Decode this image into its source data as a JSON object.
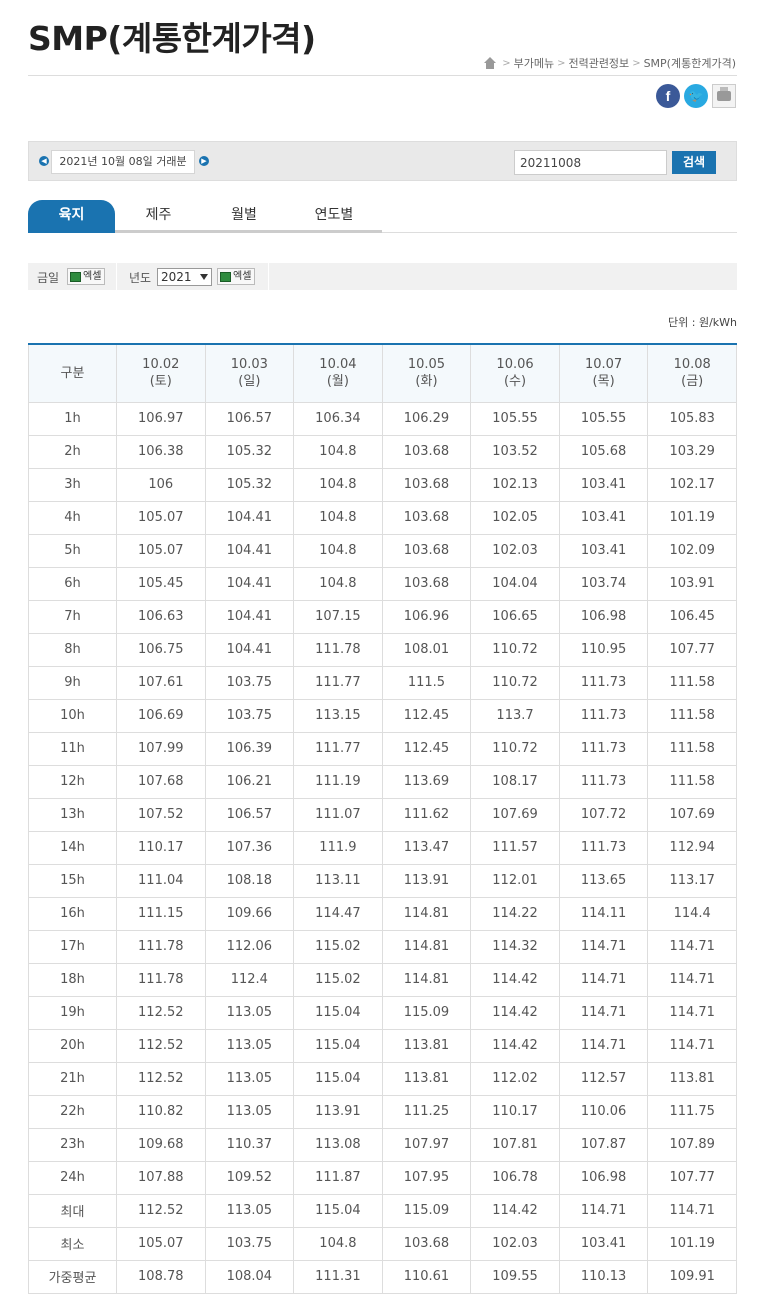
{
  "page": {
    "title": "SMP(계통한계가격)",
    "breadcrumb": [
      "부가메뉴",
      "전력관련정보",
      "SMP(계통한계가격)"
    ]
  },
  "share": {
    "facebook": "f",
    "twitter": "t",
    "print": "print-icon"
  },
  "search": {
    "date_label": "2021년 10월 08일 거래분",
    "input_value": "20211008",
    "button_label": "검색"
  },
  "tabs": [
    {
      "label": "육지",
      "active": true
    },
    {
      "label": "제주",
      "active": false
    },
    {
      "label": "월별",
      "active": false
    },
    {
      "label": "연도별",
      "active": false
    }
  ],
  "options": {
    "today_label": "금일",
    "excel_label": "엑셀",
    "year_label": "년도",
    "year_value": "2021",
    "excel_label2": "엑셀"
  },
  "unit": "단위 : 원/kWh",
  "table": {
    "first_col_header": "구분",
    "columns": [
      {
        "date": "10.02",
        "day": "(토)"
      },
      {
        "date": "10.03",
        "day": "(일)"
      },
      {
        "date": "10.04",
        "day": "(월)"
      },
      {
        "date": "10.05",
        "day": "(화)"
      },
      {
        "date": "10.06",
        "day": "(수)"
      },
      {
        "date": "10.07",
        "day": "(목)"
      },
      {
        "date": "10.08",
        "day": "(금)"
      }
    ],
    "rows": [
      {
        "label": "1h",
        "values": [
          "106.97",
          "106.57",
          "106.34",
          "106.29",
          "105.55",
          "105.55",
          "105.83"
        ]
      },
      {
        "label": "2h",
        "values": [
          "106.38",
          "105.32",
          "104.8",
          "103.68",
          "103.52",
          "105.68",
          "103.29"
        ]
      },
      {
        "label": "3h",
        "values": [
          "106",
          "105.32",
          "104.8",
          "103.68",
          "102.13",
          "103.41",
          "102.17"
        ]
      },
      {
        "label": "4h",
        "values": [
          "105.07",
          "104.41",
          "104.8",
          "103.68",
          "102.05",
          "103.41",
          "101.19"
        ]
      },
      {
        "label": "5h",
        "values": [
          "105.07",
          "104.41",
          "104.8",
          "103.68",
          "102.03",
          "103.41",
          "102.09"
        ]
      },
      {
        "label": "6h",
        "values": [
          "105.45",
          "104.41",
          "104.8",
          "103.68",
          "104.04",
          "103.74",
          "103.91"
        ]
      },
      {
        "label": "7h",
        "values": [
          "106.63",
          "104.41",
          "107.15",
          "106.96",
          "106.65",
          "106.98",
          "106.45"
        ]
      },
      {
        "label": "8h",
        "values": [
          "106.75",
          "104.41",
          "111.78",
          "108.01",
          "110.72",
          "110.95",
          "107.77"
        ]
      },
      {
        "label": "9h",
        "values": [
          "107.61",
          "103.75",
          "111.77",
          "111.5",
          "110.72",
          "111.73",
          "111.58"
        ]
      },
      {
        "label": "10h",
        "values": [
          "106.69",
          "103.75",
          "113.15",
          "112.45",
          "113.7",
          "111.73",
          "111.58"
        ]
      },
      {
        "label": "11h",
        "values": [
          "107.99",
          "106.39",
          "111.77",
          "112.45",
          "110.72",
          "111.73",
          "111.58"
        ]
      },
      {
        "label": "12h",
        "values": [
          "107.68",
          "106.21",
          "111.19",
          "113.69",
          "108.17",
          "111.73",
          "111.58"
        ]
      },
      {
        "label": "13h",
        "values": [
          "107.52",
          "106.57",
          "111.07",
          "111.62",
          "107.69",
          "107.72",
          "107.69"
        ]
      },
      {
        "label": "14h",
        "values": [
          "110.17",
          "107.36",
          "111.9",
          "113.47",
          "111.57",
          "111.73",
          "112.94"
        ]
      },
      {
        "label": "15h",
        "values": [
          "111.04",
          "108.18",
          "113.11",
          "113.91",
          "112.01",
          "113.65",
          "113.17"
        ]
      },
      {
        "label": "16h",
        "values": [
          "111.15",
          "109.66",
          "114.47",
          "114.81",
          "114.22",
          "114.11",
          "114.4"
        ]
      },
      {
        "label": "17h",
        "values": [
          "111.78",
          "112.06",
          "115.02",
          "114.81",
          "114.32",
          "114.71",
          "114.71"
        ]
      },
      {
        "label": "18h",
        "values": [
          "111.78",
          "112.4",
          "115.02",
          "114.81",
          "114.42",
          "114.71",
          "114.71"
        ]
      },
      {
        "label": "19h",
        "values": [
          "112.52",
          "113.05",
          "115.04",
          "115.09",
          "114.42",
          "114.71",
          "114.71"
        ]
      },
      {
        "label": "20h",
        "values": [
          "112.52",
          "113.05",
          "115.04",
          "113.81",
          "114.42",
          "114.71",
          "114.71"
        ]
      },
      {
        "label": "21h",
        "values": [
          "112.52",
          "113.05",
          "115.04",
          "113.81",
          "112.02",
          "112.57",
          "113.81"
        ]
      },
      {
        "label": "22h",
        "values": [
          "110.82",
          "113.05",
          "113.91",
          "111.25",
          "110.17",
          "110.06",
          "111.75"
        ]
      },
      {
        "label": "23h",
        "values": [
          "109.68",
          "110.37",
          "113.08",
          "107.97",
          "107.81",
          "107.87",
          "107.89"
        ]
      },
      {
        "label": "24h",
        "values": [
          "107.88",
          "109.52",
          "111.87",
          "107.95",
          "106.78",
          "106.98",
          "107.77"
        ]
      },
      {
        "label": "최대",
        "values": [
          "112.52",
          "113.05",
          "115.04",
          "115.09",
          "114.42",
          "114.71",
          "114.71"
        ]
      },
      {
        "label": "최소",
        "values": [
          "105.07",
          "103.75",
          "104.8",
          "103.68",
          "102.03",
          "103.41",
          "101.19"
        ]
      },
      {
        "label": "가중평균",
        "values": [
          "108.78",
          "108.04",
          "111.31",
          "110.61",
          "109.55",
          "110.13",
          "109.91"
        ]
      }
    ]
  },
  "colors": {
    "accent": "#1a73b0",
    "header_bg": "#f4f9fc"
  }
}
